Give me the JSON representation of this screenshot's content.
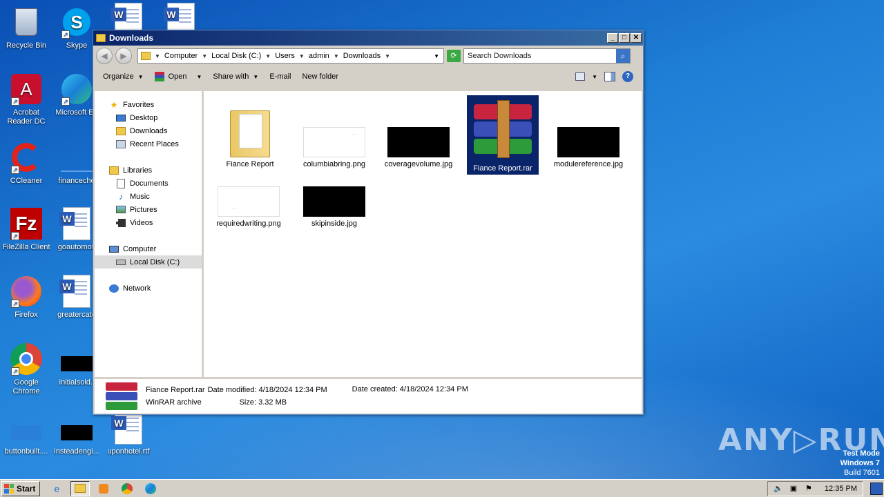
{
  "desktop": {
    "icons": [
      {
        "label": "Recycle Bin"
      },
      {
        "label": "Skype"
      },
      {
        "label": "Acrobat Reader DC"
      },
      {
        "label": "Microsoft Ed"
      },
      {
        "label": "CCleaner"
      },
      {
        "label": "financeche"
      },
      {
        "label": "FileZilla Client"
      },
      {
        "label": "goautomoti"
      },
      {
        "label": "Firefox"
      },
      {
        "label": "greatercate"
      },
      {
        "label": "Google Chrome"
      },
      {
        "label": "initialsold.j"
      },
      {
        "label": "buttonbuilt...."
      },
      {
        "label": "insteadengi..."
      },
      {
        "label": "uponhotel.rtf"
      }
    ]
  },
  "window": {
    "title": "Downloads",
    "minimize": "_",
    "maximize": "□",
    "close": "✕",
    "breadcrumb": [
      "Computer",
      "Local Disk (C:)",
      "Users",
      "admin",
      "Downloads"
    ],
    "search_placeholder": "Search Downloads",
    "toolbar": {
      "organize": "Organize",
      "open": "Open",
      "share_with": "Share with",
      "email": "E-mail",
      "new_folder": "New folder",
      "help": "?"
    },
    "nav": {
      "favorites": "Favorites",
      "desktop": "Desktop",
      "downloads": "Downloads",
      "recent_places": "Recent Places",
      "libraries": "Libraries",
      "documents": "Documents",
      "music": "Music",
      "pictures": "Pictures",
      "videos": "Videos",
      "computer": "Computer",
      "local_disk": "Local Disk (C:)",
      "network": "Network"
    },
    "files": [
      {
        "name": "Fiance Report",
        "type": "folder"
      },
      {
        "name": "columbiabring.png",
        "type": "white"
      },
      {
        "name": "coveragevolume.jpg",
        "type": "black"
      },
      {
        "name": "Fiance Report.rar",
        "type": "rar",
        "selected": true
      },
      {
        "name": "modulereference.jpg",
        "type": "black"
      },
      {
        "name": "requiredwriting.png",
        "type": "white"
      },
      {
        "name": "skipinside.jpg",
        "type": "black"
      }
    ],
    "details": {
      "name": "Fiance Report.rar",
      "type": "WinRAR archive",
      "modified_label": "Date modified:",
      "modified": "4/18/2024 12:34 PM",
      "created_label": "Date created:",
      "created": "4/18/2024 12:34 PM",
      "size_label": "Size:",
      "size": "3.32 MB"
    }
  },
  "taskbar": {
    "start": "Start",
    "clock": "12:35 PM"
  },
  "watermark": {
    "line1": "Test Mode",
    "line2": "Windows 7",
    "line3": "Build 7601",
    "brand": "ANY▷RUN"
  }
}
